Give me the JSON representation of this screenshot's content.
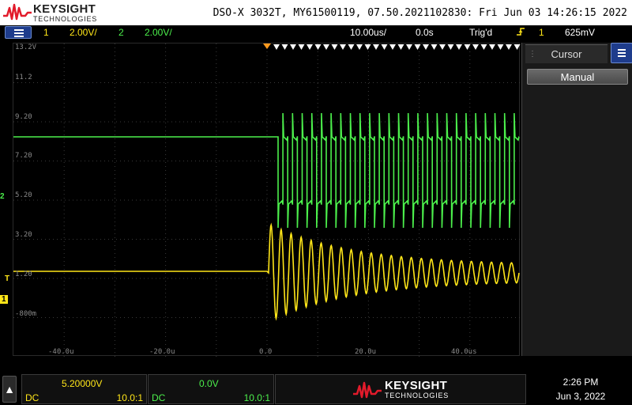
{
  "brand": {
    "name": "KEYSIGHT",
    "tagline": "TECHNOLOGIES"
  },
  "header": {
    "instrument_info": "DSO-X 3032T, MY61500119, 07.50.2021102830: Fri Jun 03 14:26:15 2022"
  },
  "status": {
    "ch1_number": "1",
    "ch1_scale": "2.00V/",
    "ch2_number": "2",
    "ch2_scale": "2.00V/",
    "timebase": "10.00us/",
    "delay": "0.0s",
    "trigger_state": "Trig'd",
    "trigger_icon": "trigger-edge-icon",
    "trigger_source": "1",
    "trigger_level": "625mV"
  },
  "grid": {
    "y_labels": [
      "13.2V",
      "11.2",
      "9.20",
      "7.20",
      "5.20",
      "3.20",
      "1.20",
      "-800m"
    ],
    "x_labels": [
      "-40.0u",
      "-20.0u",
      "0.0",
      "20.0u",
      "40.0us"
    ]
  },
  "markers": {
    "ch2": "2",
    "trigger": "T",
    "ch1": "1"
  },
  "right_panel": {
    "tab_label": "Cursor",
    "mode_button": "Manual"
  },
  "bottom": {
    "ch1": {
      "offset": "5.20000V",
      "coupling": "DC",
      "probe": "10.0:1"
    },
    "ch2": {
      "offset": "0.0V",
      "coupling": "DC",
      "probe": "10.0:1"
    }
  },
  "clock": {
    "time": "2:26 PM",
    "date": "Jun 3, 2022"
  },
  "colors": {
    "ch1": "#ffe619",
    "ch2": "#4cf04c",
    "grid": "#3a3a3a",
    "accent": "#1e3c8c",
    "logo_red": "#e21b2b"
  }
}
